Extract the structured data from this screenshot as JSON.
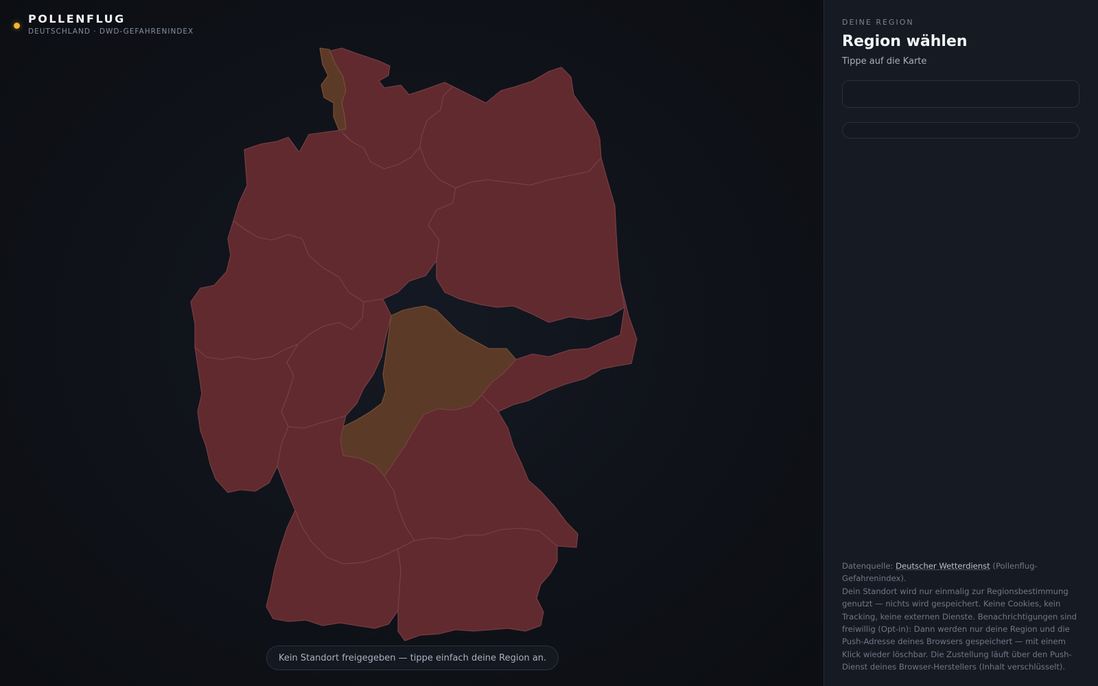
{
  "app": {
    "title": "POLLENFLUG",
    "subtitle": "DEUTSCHLAND · DWD-GEFAHRENINDEX",
    "status_dot_color": "#f2b531"
  },
  "map": {
    "status_message": "Kein Standort freigegeben — tippe einfach deine Region an.",
    "level_colors": {
      "high": "#612a2f",
      "moderate": "#5c3a28"
    }
  },
  "sidebar": {
    "eyebrow": "DEINE REGION",
    "title": "Region wählen",
    "hint": "Tippe auf die Karte"
  },
  "footer": {
    "source_prefix": "Datenquelle: ",
    "source_link": "Deutscher Wetterdienst",
    "source_suffix": " (Pollenflug-Gefahrenindex).",
    "privacy": "Dein Standort wird nur einmalig zur Regionsbestimmung genutzt — nichts wird gespeichert. Keine Cookies, kein Tracking, keine externen Dienste. Benachrichtigungen sind freiwillig (Opt-in): Dann werden nur deine Region und die Push-Adresse deines Browsers gespeichert — mit einem Klick wieder löschbar. Die Zustellung läuft über den Push-Dienst deines Browser-Herstellers (Inhalt verschlüsselt)."
  }
}
